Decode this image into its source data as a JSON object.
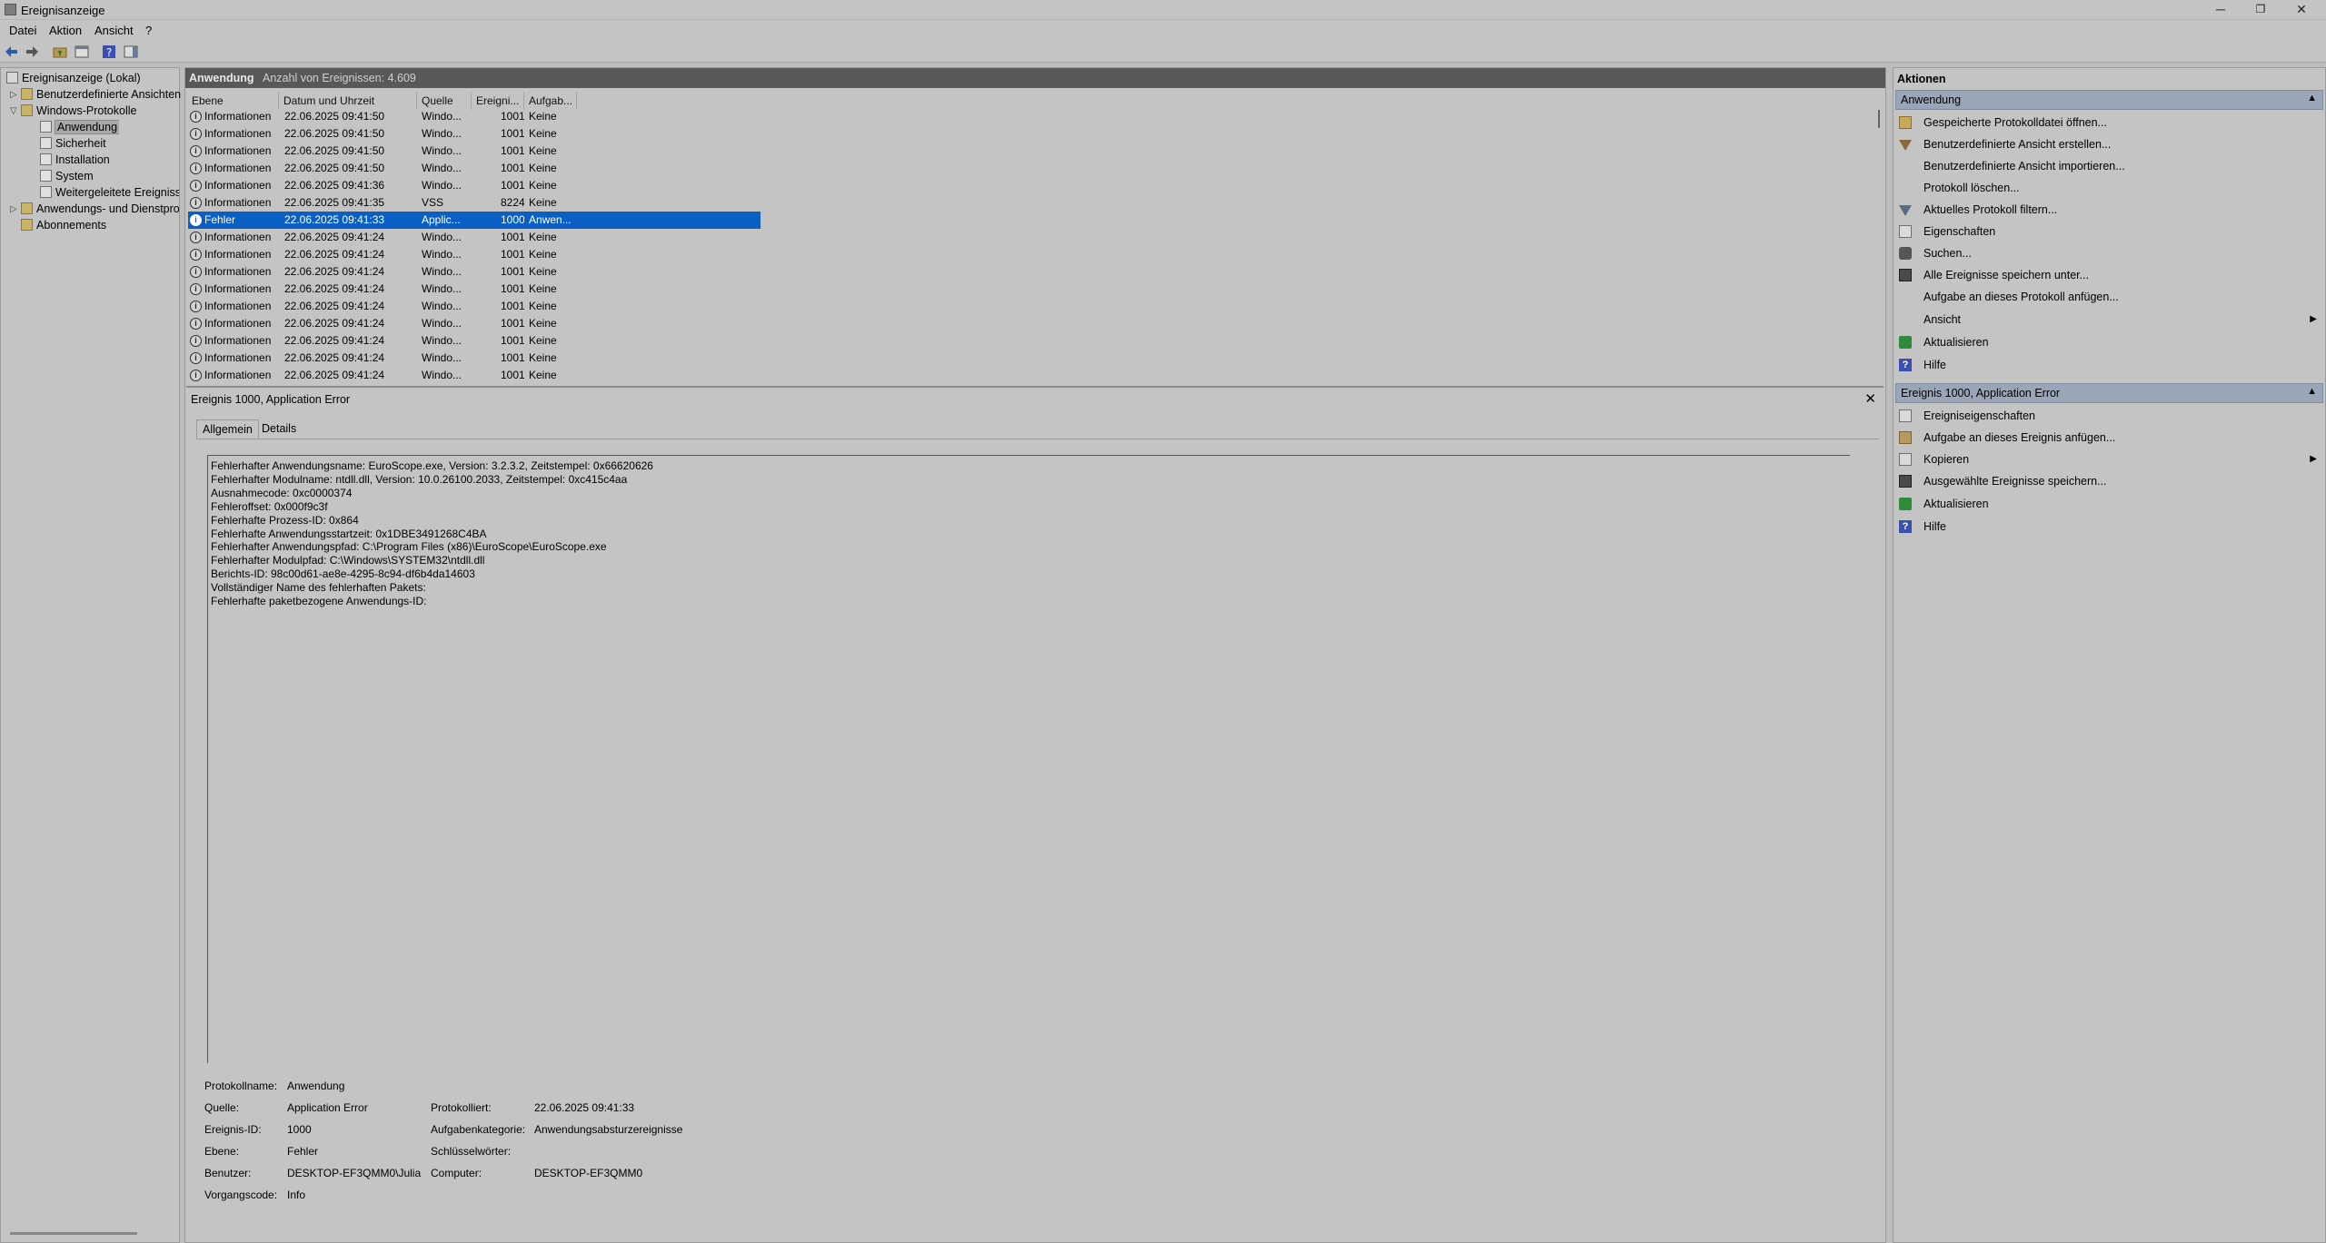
{
  "window": {
    "title": "Ereignisanzeige",
    "minimize": "─",
    "maximize": "❐",
    "close": "✕"
  },
  "menu": {
    "items": [
      "Datei",
      "Aktion",
      "Ansicht",
      "?"
    ]
  },
  "tree": {
    "items": [
      {
        "label": "Ereignisanzeige (Lokal)"
      },
      {
        "label": "Benutzerdefinierte Ansichten"
      },
      {
        "label": "Windows-Protokolle"
      },
      {
        "label": "Anwendung"
      },
      {
        "label": "Sicherheit"
      },
      {
        "label": "Installation"
      },
      {
        "label": "System"
      },
      {
        "label": "Weitergeleitete Ereignisse"
      },
      {
        "label": "Anwendungs- und Dienstprotokolle"
      },
      {
        "label": "Abonnements"
      }
    ]
  },
  "log": {
    "name": "Anwendung",
    "count_text": "Anzahl von Ereignissen: 4.609",
    "columns": [
      "Ebene",
      "Datum und Uhrzeit",
      "Quelle",
      "Ereigni...",
      "Aufgab..."
    ],
    "rows": [
      {
        "level": "Informationen",
        "date": "22.06.2025 09:41:50",
        "source": "Windo...",
        "id": "1001",
        "task": "Keine"
      },
      {
        "level": "Informationen",
        "date": "22.06.2025 09:41:50",
        "source": "Windo...",
        "id": "1001",
        "task": "Keine"
      },
      {
        "level": "Informationen",
        "date": "22.06.2025 09:41:50",
        "source": "Windo...",
        "id": "1001",
        "task": "Keine"
      },
      {
        "level": "Informationen",
        "date": "22.06.2025 09:41:50",
        "source": "Windo...",
        "id": "1001",
        "task": "Keine"
      },
      {
        "level": "Informationen",
        "date": "22.06.2025 09:41:36",
        "source": "Windo...",
        "id": "1001",
        "task": "Keine"
      },
      {
        "level": "Informationen",
        "date": "22.06.2025 09:41:35",
        "source": "VSS",
        "id": "8224",
        "task": "Keine"
      },
      {
        "level": "Fehler",
        "date": "22.06.2025 09:41:33",
        "source": "Applic...",
        "id": "1000",
        "task": "Anwen..."
      },
      {
        "level": "Informationen",
        "date": "22.06.2025 09:41:24",
        "source": "Windo...",
        "id": "1001",
        "task": "Keine"
      },
      {
        "level": "Informationen",
        "date": "22.06.2025 09:41:24",
        "source": "Windo...",
        "id": "1001",
        "task": "Keine"
      },
      {
        "level": "Informationen",
        "date": "22.06.2025 09:41:24",
        "source": "Windo...",
        "id": "1001",
        "task": "Keine"
      },
      {
        "level": "Informationen",
        "date": "22.06.2025 09:41:24",
        "source": "Windo...",
        "id": "1001",
        "task": "Keine"
      },
      {
        "level": "Informationen",
        "date": "22.06.2025 09:41:24",
        "source": "Windo...",
        "id": "1001",
        "task": "Keine"
      },
      {
        "level": "Informationen",
        "date": "22.06.2025 09:41:24",
        "source": "Windo...",
        "id": "1001",
        "task": "Keine"
      },
      {
        "level": "Informationen",
        "date": "22.06.2025 09:41:24",
        "source": "Windo...",
        "id": "1001",
        "task": "Keine"
      },
      {
        "level": "Informationen",
        "date": "22.06.2025 09:41:24",
        "source": "Windo...",
        "id": "1001",
        "task": "Keine"
      },
      {
        "level": "Informationen",
        "date": "22.06.2025 09:41:24",
        "source": "Windo...",
        "id": "1001",
        "task": "Keine"
      }
    ]
  },
  "detail": {
    "title": "Ereignis 1000, Application Error",
    "close": "✕",
    "tabs": [
      "Allgemein",
      "Details"
    ],
    "description": [
      "Fehlerhafter Anwendungsname: EuroScope.exe, Version: 3.2.3.2, Zeitstempel: 0x66620626",
      "Fehlerhafter Modulname: ntdll.dll, Version: 10.0.26100.2033, Zeitstempel: 0xc415c4aa",
      "Ausnahmecode: 0xc0000374",
      "Fehleroffset: 0x000f9c3f",
      "Fehlerhafte Prozess-ID: 0x864",
      "Fehlerhafte Anwendungsstartzeit: 0x1DBE3491268C4BA",
      "Fehlerhafter Anwendungspfad: C:\\Program Files (x86)\\EuroScope\\EuroScope.exe",
      "Fehlerhafter Modulpfad: C:\\Windows\\SYSTEM32\\ntdll.dll",
      "Berichts-ID: 98c00d61-ae8e-4295-8c94-df6b4da14603",
      "Vollständiger Name des fehlerhaften Pakets:",
      "Fehlerhafte paketbezogene Anwendungs-ID:"
    ],
    "meta": {
      "log_name_label": "Protokollname:",
      "log_name": "Anwendung",
      "source_label": "Quelle:",
      "source": "Application Error",
      "logged_label": "Protokolliert:",
      "logged": "22.06.2025 09:41:33",
      "event_id_label": "Ereignis-ID:",
      "event_id": "1000",
      "task_cat_label": "Aufgabenkategorie:",
      "task_cat": "Anwendungsabsturzereignisse",
      "level_label": "Ebene:",
      "level": "Fehler",
      "keywords_label": "Schlüsselwörter:",
      "keywords": "",
      "user_label": "Benutzer:",
      "user": "DESKTOP-EF3QMM0\\Julia",
      "computer_label": "Computer:",
      "computer": "DESKTOP-EF3QMM0",
      "opcode_label": "Vorgangscode:",
      "opcode": "Info"
    }
  },
  "actions": {
    "title": "Aktionen",
    "section1": {
      "title": "Anwendung",
      "items": [
        {
          "label": "Gespeicherte Protokolldatei öffnen...",
          "icon": "folder-icon"
        },
        {
          "label": "Benutzerdefinierte Ansicht erstellen...",
          "icon": "filter-icon"
        },
        {
          "label": "Benutzerdefinierte Ansicht importieren...",
          "icon": ""
        },
        {
          "label": "Protokoll löschen...",
          "icon": ""
        },
        {
          "label": "Aktuelles Protokoll filtern...",
          "icon": "filter-icon"
        },
        {
          "label": "Eigenschaften",
          "icon": "properties-icon"
        },
        {
          "label": "Suchen...",
          "icon": "binoculars-icon"
        },
        {
          "label": "Alle Ereignisse speichern unter...",
          "icon": "save-icon"
        },
        {
          "label": "Aufgabe an dieses Protokoll anfügen...",
          "icon": ""
        },
        {
          "label": "Ansicht",
          "icon": "",
          "submenu": true
        },
        {
          "label": "Aktualisieren",
          "icon": "refresh-icon"
        },
        {
          "label": "Hilfe",
          "icon": "help-icon"
        }
      ]
    },
    "section2": {
      "title": "Ereignis 1000, Application Error",
      "items": [
        {
          "label": "Ereigniseigenschaften",
          "icon": "properties-icon"
        },
        {
          "label": "Aufgabe an dieses Ereignis anfügen...",
          "icon": "task-icon"
        },
        {
          "label": "Kopieren",
          "icon": "copy-icon",
          "submenu": true
        },
        {
          "label": "Ausgewählte Ereignisse speichern...",
          "icon": "save-icon"
        },
        {
          "label": "Aktualisieren",
          "icon": "refresh-icon"
        },
        {
          "label": "Hilfe",
          "icon": "help-icon"
        }
      ]
    },
    "caret": "▲",
    "submenu_arrow": "▶"
  },
  "colors": {
    "selection": "#0a5fc4",
    "header": "#585858",
    "section": "#9aa6b8"
  }
}
